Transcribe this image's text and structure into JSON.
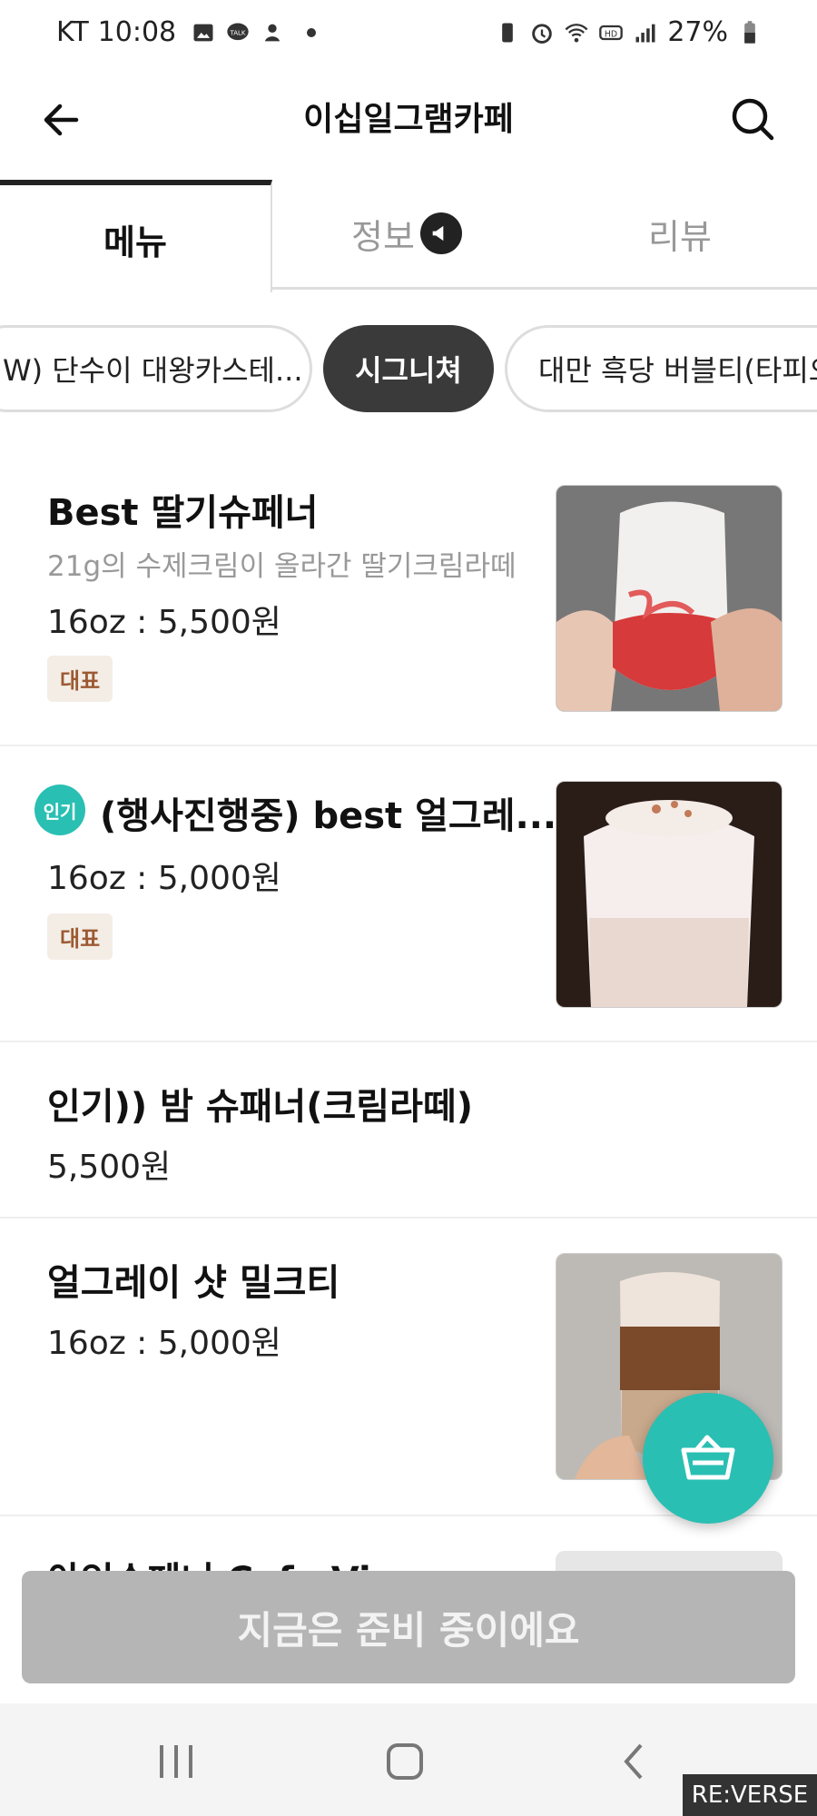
{
  "status": {
    "carrier": "KT",
    "time": "10:08",
    "battery": "27%"
  },
  "header": {
    "title": "이십일그램카페"
  },
  "tabs": {
    "menu": "메뉴",
    "info": "정보",
    "review": "리뷰"
  },
  "chips": [
    "W) 단수이 대왕카스테...",
    "시그니쳐",
    "대만 흑당 버블티(타피오"
  ],
  "items": [
    {
      "name": "Best 딸기슈페너",
      "desc": "21g의 수제크림이 올라간 딸기크림라떼",
      "price": "16oz : 5,500원",
      "badge": "대표"
    },
    {
      "popular": "인기",
      "name": "(행사진행중) best 얼그레...",
      "price": "16oz : 5,000원",
      "badge": "대표"
    },
    {
      "name": "인기)) 밤 슈패너(크림라떼)",
      "price": "5,500원"
    },
    {
      "name": "얼그레이 샷 밀크티",
      "price": "16oz : 5,000원"
    },
    {
      "name": "아인슈페너 Cafe Vienna"
    }
  ],
  "footer": {
    "prepare_label": "지금은 준비 중이에요"
  },
  "watermark": "RE:VERSE",
  "colors": {
    "accent": "#2abfb3",
    "chip_active": "#3a3a3a",
    "badge_bg": "#f3ede6",
    "badge_text": "#9c5a32"
  }
}
